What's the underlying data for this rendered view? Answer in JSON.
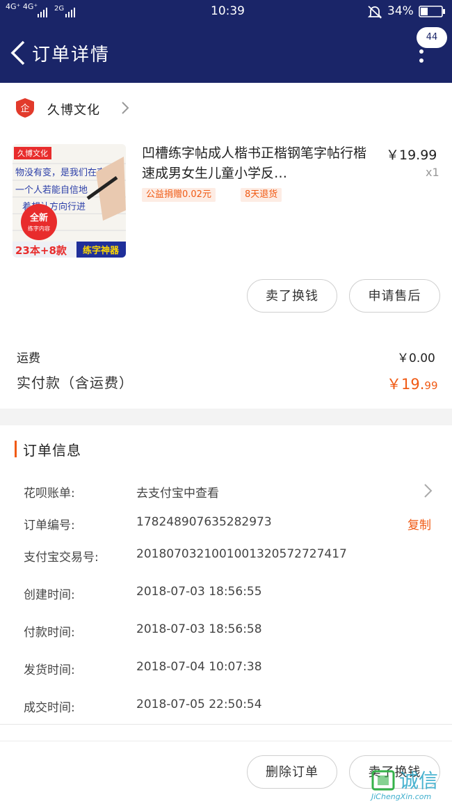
{
  "status_bar": {
    "time": "10:39",
    "signal_left": "4G⁺ 4G⁺",
    "signal_right": "2G",
    "battery": "34%"
  },
  "nav": {
    "title": "订单详情",
    "badge": "44"
  },
  "store": {
    "name": "久博文化"
  },
  "product": {
    "name": "凹槽练字帖成人楷书正楷钢笔字帖行楷速成男女生儿童小学反…",
    "price": "￥19.99",
    "qty": "x1",
    "tags": [
      "公益捐赠0.02元",
      "8天退货"
    ],
    "thumb_text": {
      "brand": "久博文化",
      "new_line1": "全新",
      "new_line2": "练字内容",
      "count": "23本+8款",
      "slogan": "练字神器",
      "script_line1": "物没有变，是我们在变",
      "script_line2": "一个人若能自信地",
      "script_line3": "着想认方向行进"
    }
  },
  "actions": {
    "sell": "卖了换钱",
    "after_sale": "申请售后"
  },
  "fees": {
    "shipping_label": "运费",
    "shipping_value": "￥0.00",
    "paid_label": "实付款（含运费）",
    "paid_currency_int": "￥19.",
    "paid_decimal": "99"
  },
  "order_info": {
    "title": "订单信息",
    "rows": [
      {
        "label": "花呗账单:",
        "value": "去支付宝中查看"
      },
      {
        "label": "订单编号:",
        "value": "178248907635282973"
      },
      {
        "label": "支付宝交易号:",
        "value": "2018070321001001320572727417"
      },
      {
        "label": "创建时间:",
        "value": "2018-07-03 18:56:55"
      },
      {
        "label": "付款时间:",
        "value": "2018-07-03 18:56:58"
      },
      {
        "label": "发货时间:",
        "value": "2018-07-04 10:07:38"
      },
      {
        "label": "成交时间:",
        "value": "2018-07-05 22:50:54"
      }
    ],
    "copy": "复制"
  },
  "bottom": {
    "delete": "删除订单",
    "sell": "卖了换钱"
  },
  "watermark": {
    "cn": "诚信",
    "en": "JiChengXin.com"
  },
  "colors": {
    "nav_bg": "#1a2568",
    "accent": "#f05a14"
  }
}
